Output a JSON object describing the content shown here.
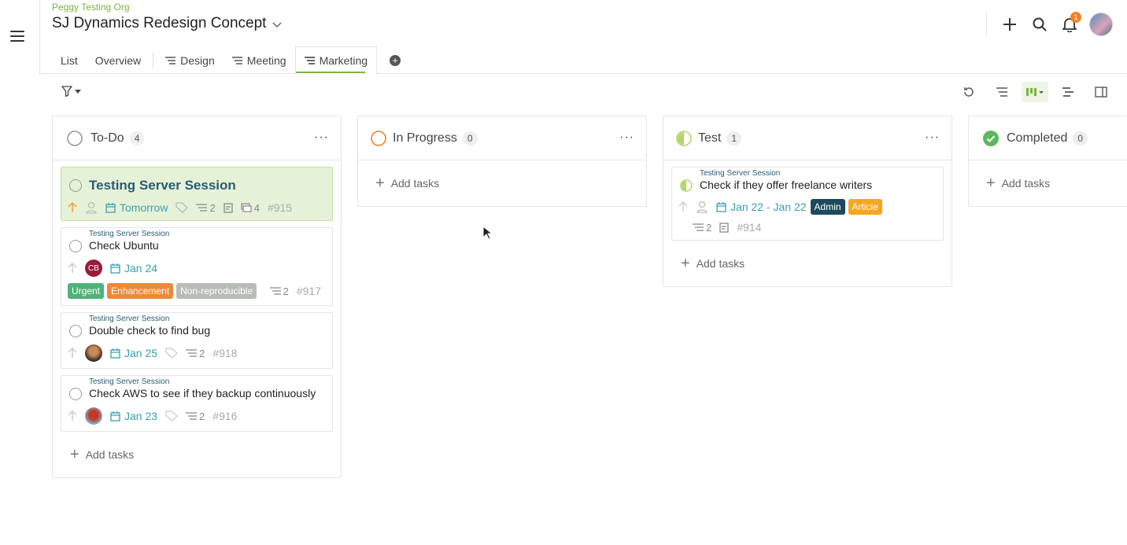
{
  "header": {
    "org": "Peggy Testing Org",
    "project_title": "SJ Dynamics Redesign Concept",
    "notifications_count": "1"
  },
  "tabs": [
    {
      "label": "List",
      "icon": ""
    },
    {
      "label": "Overview",
      "icon": ""
    },
    {
      "label": "Design",
      "icon": "list-lines-icon"
    },
    {
      "label": "Meeting",
      "icon": "list-lines-icon"
    },
    {
      "label": "Marketing",
      "icon": "list-lines-icon",
      "active": true
    }
  ],
  "columns": [
    {
      "title": "To-Do",
      "count": "4",
      "status_color": "#999",
      "add_label": "Add tasks",
      "cards": [
        {
          "parent": "",
          "title": "Testing Server Session",
          "date": "Tomorrow",
          "subtasks": "2",
          "attachments": "4",
          "id": "#915",
          "highlight": true
        },
        {
          "parent": "Testing Server Session",
          "title": "Check Ubuntu",
          "assignee_initials": "CB",
          "date": "Jan 24",
          "tags": [
            "Urgent",
            "Enhancement",
            "Non-reproducible"
          ],
          "subtasks": "2",
          "id": "#917"
        },
        {
          "parent": "Testing Server Session",
          "title": "Double check to find bug",
          "date": "Jan 25",
          "subtasks": "2",
          "id": "#918"
        },
        {
          "parent": "Testing Server Session",
          "title": "Check AWS to see if they backup continuously",
          "date": "Jan 23",
          "subtasks": "2",
          "id": "#916"
        }
      ]
    },
    {
      "title": "In Progress",
      "count": "0",
      "status_color": "#f0832a",
      "add_label": "Add tasks"
    },
    {
      "title": "Test",
      "count": "1",
      "status_color": "#b5d66e",
      "add_label": "Add tasks",
      "cards": [
        {
          "parent": "Testing Server Session",
          "title": "Check if they offer freelance writers",
          "date": "Jan 22 - Jan 22",
          "tags": [
            "Admin",
            "Article"
          ],
          "subtasks": "2",
          "id": "#914"
        }
      ]
    },
    {
      "title": "Completed",
      "count": "0",
      "status_color": "#5cb85c",
      "add_label": "Add tasks"
    }
  ],
  "colors": {
    "accent": "#7cb342",
    "tag_urgent": "#4fb27a",
    "tag_enhancement": "#f0883a",
    "tag_nonrepro": "#b7bcb7",
    "tag_admin": "#1c4a5c",
    "tag_article": "#f5a623",
    "date": "#3aa0b0"
  }
}
